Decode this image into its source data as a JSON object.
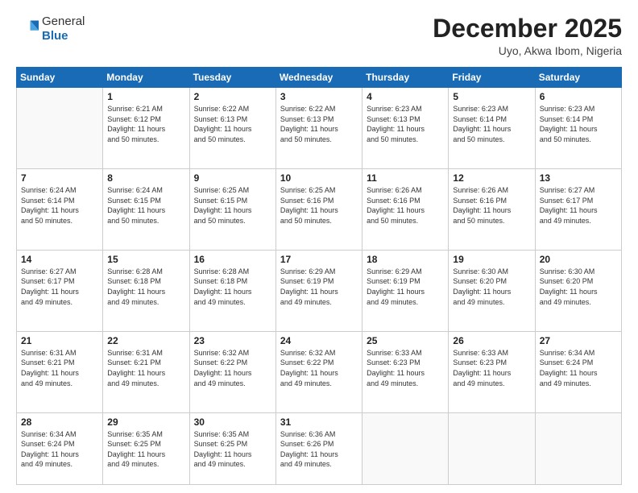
{
  "logo": {
    "general": "General",
    "blue": "Blue"
  },
  "header": {
    "month": "December 2025",
    "location": "Uyo, Akwa Ibom, Nigeria"
  },
  "days_of_week": [
    "Sunday",
    "Monday",
    "Tuesday",
    "Wednesday",
    "Thursday",
    "Friday",
    "Saturday"
  ],
  "weeks": [
    [
      {
        "day": "",
        "info": ""
      },
      {
        "day": "1",
        "info": "Sunrise: 6:21 AM\nSunset: 6:12 PM\nDaylight: 11 hours\nand 50 minutes."
      },
      {
        "day": "2",
        "info": "Sunrise: 6:22 AM\nSunset: 6:13 PM\nDaylight: 11 hours\nand 50 minutes."
      },
      {
        "day": "3",
        "info": "Sunrise: 6:22 AM\nSunset: 6:13 PM\nDaylight: 11 hours\nand 50 minutes."
      },
      {
        "day": "4",
        "info": "Sunrise: 6:23 AM\nSunset: 6:13 PM\nDaylight: 11 hours\nand 50 minutes."
      },
      {
        "day": "5",
        "info": "Sunrise: 6:23 AM\nSunset: 6:14 PM\nDaylight: 11 hours\nand 50 minutes."
      },
      {
        "day": "6",
        "info": "Sunrise: 6:23 AM\nSunset: 6:14 PM\nDaylight: 11 hours\nand 50 minutes."
      }
    ],
    [
      {
        "day": "7",
        "info": "Sunrise: 6:24 AM\nSunset: 6:14 PM\nDaylight: 11 hours\nand 50 minutes."
      },
      {
        "day": "8",
        "info": "Sunrise: 6:24 AM\nSunset: 6:15 PM\nDaylight: 11 hours\nand 50 minutes."
      },
      {
        "day": "9",
        "info": "Sunrise: 6:25 AM\nSunset: 6:15 PM\nDaylight: 11 hours\nand 50 minutes."
      },
      {
        "day": "10",
        "info": "Sunrise: 6:25 AM\nSunset: 6:16 PM\nDaylight: 11 hours\nand 50 minutes."
      },
      {
        "day": "11",
        "info": "Sunrise: 6:26 AM\nSunset: 6:16 PM\nDaylight: 11 hours\nand 50 minutes."
      },
      {
        "day": "12",
        "info": "Sunrise: 6:26 AM\nSunset: 6:16 PM\nDaylight: 11 hours\nand 50 minutes."
      },
      {
        "day": "13",
        "info": "Sunrise: 6:27 AM\nSunset: 6:17 PM\nDaylight: 11 hours\nand 49 minutes."
      }
    ],
    [
      {
        "day": "14",
        "info": "Sunrise: 6:27 AM\nSunset: 6:17 PM\nDaylight: 11 hours\nand 49 minutes."
      },
      {
        "day": "15",
        "info": "Sunrise: 6:28 AM\nSunset: 6:18 PM\nDaylight: 11 hours\nand 49 minutes."
      },
      {
        "day": "16",
        "info": "Sunrise: 6:28 AM\nSunset: 6:18 PM\nDaylight: 11 hours\nand 49 minutes."
      },
      {
        "day": "17",
        "info": "Sunrise: 6:29 AM\nSunset: 6:19 PM\nDaylight: 11 hours\nand 49 minutes."
      },
      {
        "day": "18",
        "info": "Sunrise: 6:29 AM\nSunset: 6:19 PM\nDaylight: 11 hours\nand 49 minutes."
      },
      {
        "day": "19",
        "info": "Sunrise: 6:30 AM\nSunset: 6:20 PM\nDaylight: 11 hours\nand 49 minutes."
      },
      {
        "day": "20",
        "info": "Sunrise: 6:30 AM\nSunset: 6:20 PM\nDaylight: 11 hours\nand 49 minutes."
      }
    ],
    [
      {
        "day": "21",
        "info": "Sunrise: 6:31 AM\nSunset: 6:21 PM\nDaylight: 11 hours\nand 49 minutes."
      },
      {
        "day": "22",
        "info": "Sunrise: 6:31 AM\nSunset: 6:21 PM\nDaylight: 11 hours\nand 49 minutes."
      },
      {
        "day": "23",
        "info": "Sunrise: 6:32 AM\nSunset: 6:22 PM\nDaylight: 11 hours\nand 49 minutes."
      },
      {
        "day": "24",
        "info": "Sunrise: 6:32 AM\nSunset: 6:22 PM\nDaylight: 11 hours\nand 49 minutes."
      },
      {
        "day": "25",
        "info": "Sunrise: 6:33 AM\nSunset: 6:23 PM\nDaylight: 11 hours\nand 49 minutes."
      },
      {
        "day": "26",
        "info": "Sunrise: 6:33 AM\nSunset: 6:23 PM\nDaylight: 11 hours\nand 49 minutes."
      },
      {
        "day": "27",
        "info": "Sunrise: 6:34 AM\nSunset: 6:24 PM\nDaylight: 11 hours\nand 49 minutes."
      }
    ],
    [
      {
        "day": "28",
        "info": "Sunrise: 6:34 AM\nSunset: 6:24 PM\nDaylight: 11 hours\nand 49 minutes."
      },
      {
        "day": "29",
        "info": "Sunrise: 6:35 AM\nSunset: 6:25 PM\nDaylight: 11 hours\nand 49 minutes."
      },
      {
        "day": "30",
        "info": "Sunrise: 6:35 AM\nSunset: 6:25 PM\nDaylight: 11 hours\nand 49 minutes."
      },
      {
        "day": "31",
        "info": "Sunrise: 6:36 AM\nSunset: 6:26 PM\nDaylight: 11 hours\nand 49 minutes."
      },
      {
        "day": "",
        "info": ""
      },
      {
        "day": "",
        "info": ""
      },
      {
        "day": "",
        "info": ""
      }
    ]
  ]
}
